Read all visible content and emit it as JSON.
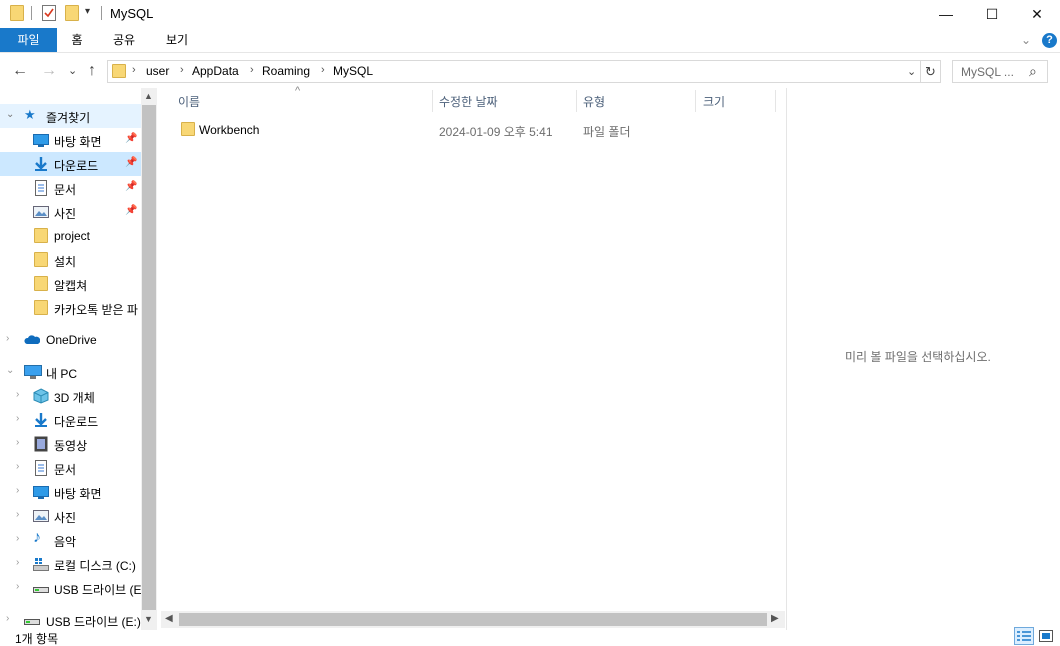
{
  "window": {
    "title": "MySQL",
    "controls": {
      "minimize": "—",
      "maximize": "☐",
      "close": "✕"
    }
  },
  "ribbon": {
    "tabs": [
      "파일",
      "홈",
      "공유",
      "보기"
    ],
    "expand": "⌄",
    "help": "?"
  },
  "nav": {
    "back": "←",
    "forward": "→",
    "recent": "⌄",
    "up": "↑",
    "breadcrumb": [
      "user",
      "AppData",
      "Roaming",
      "MySQL"
    ],
    "sep": "›",
    "dropdown": "⌄",
    "refresh": "↻",
    "search_placeholder": "MySQL ...",
    "search_icon": "⌕"
  },
  "sidebar": {
    "quick_access": {
      "label": "즐겨찾기",
      "items": [
        {
          "label": "바탕 화면",
          "icon": "desktop-icon",
          "pinned": true
        },
        {
          "label": "다운로드",
          "icon": "download-icon",
          "pinned": true
        },
        {
          "label": "문서",
          "icon": "document-icon",
          "pinned": true
        },
        {
          "label": "사진",
          "icon": "pictures-icon",
          "pinned": true
        },
        {
          "label": "project",
          "icon": "folder-icon",
          "pinned": false
        },
        {
          "label": "설치",
          "icon": "folder-icon",
          "pinned": false
        },
        {
          "label": "알캡쳐",
          "icon": "folder-icon",
          "pinned": false
        },
        {
          "label": "카카오톡 받은 파",
          "icon": "folder-icon",
          "pinned": false
        }
      ]
    },
    "onedrive": {
      "label": "OneDrive"
    },
    "this_pc": {
      "label": "내 PC",
      "items": [
        {
          "label": "3D 개체",
          "icon": "3d-objects-icon"
        },
        {
          "label": "다운로드",
          "icon": "download-icon"
        },
        {
          "label": "동영상",
          "icon": "videos-icon"
        },
        {
          "label": "문서",
          "icon": "document-icon"
        },
        {
          "label": "바탕 화면",
          "icon": "desktop-icon"
        },
        {
          "label": "사진",
          "icon": "pictures-icon"
        },
        {
          "label": "음악",
          "icon": "music-icon"
        },
        {
          "label": "로컬 디스크 (C:)",
          "icon": "local-disk-icon"
        },
        {
          "label": "USB 드라이브 (E",
          "icon": "usb-drive-icon"
        }
      ]
    },
    "usb_root": {
      "label": "USB 드라이브 (E:)"
    },
    "pin": "📌"
  },
  "content": {
    "columns": [
      "이름",
      "수정한 날짜",
      "유형",
      "크기"
    ],
    "sort_indicator": "^",
    "rows": [
      {
        "name": "Workbench",
        "modified": "2024-01-09 오후 5:41",
        "type": "파일 폴더",
        "size": ""
      }
    ]
  },
  "preview": {
    "message": "미리 볼 파일을 선택하십시오."
  },
  "status": {
    "count": "1개 항목"
  },
  "colors": {
    "accent": "#1979ca",
    "selection": "#cce8ff",
    "folder": "#f8d775"
  }
}
